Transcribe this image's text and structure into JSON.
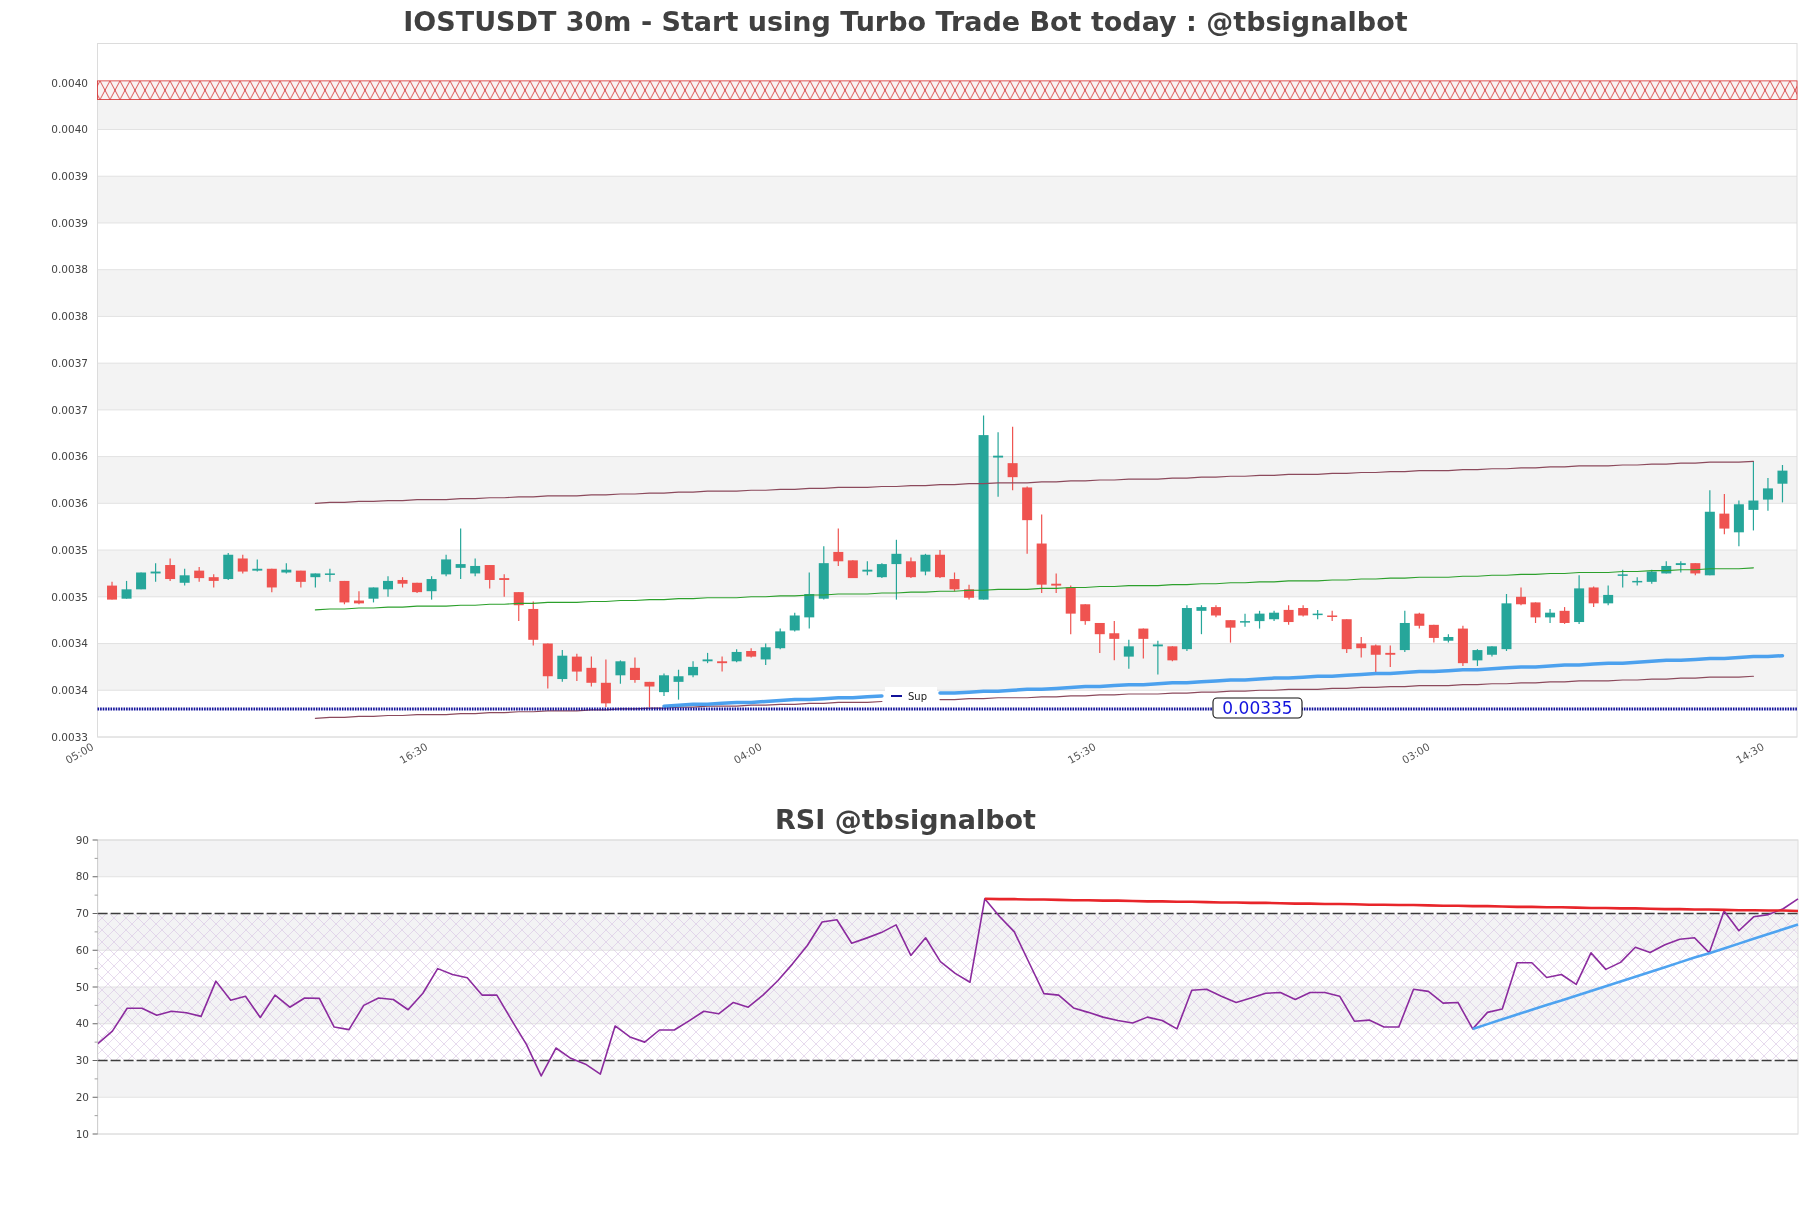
{
  "price_chart": {
    "chart_data": {
      "type": "candlestick",
      "title": "IOSTUSDT 30m - Start using Turbo Trade Bot today : @tbsignalbot",
      "grid": true,
      "categories": [
        "05:00",
        null,
        null,
        null,
        null,
        null,
        null,
        null,
        null,
        null,
        null,
        null,
        null,
        null,
        null,
        null,
        null,
        null,
        null,
        null,
        null,
        null,
        null,
        "16:30",
        null,
        null,
        null,
        null,
        null,
        null,
        null,
        null,
        null,
        null,
        null,
        null,
        null,
        null,
        null,
        null,
        null,
        null,
        null,
        null,
        null,
        null,
        "04:00",
        null,
        null,
        null,
        null,
        null,
        null,
        null,
        null,
        null,
        null,
        null,
        null,
        null,
        null,
        null,
        null,
        null,
        null,
        null,
        null,
        null,
        null,
        "15:30",
        null,
        null,
        null,
        null,
        null,
        null,
        null,
        null,
        null,
        null,
        null,
        null,
        null,
        null,
        null,
        null,
        null,
        null,
        null,
        null,
        null,
        null,
        "03:00",
        null,
        null,
        null,
        null,
        null,
        null,
        null,
        null,
        null,
        null,
        null,
        null,
        null,
        null,
        null,
        null,
        null,
        null,
        null,
        null,
        null,
        null,
        "14:30",
        null
      ],
      "ylim": [
        0.00332,
        0.004062
      ],
      "yticks": [
        {
          "value": 0.00332,
          "label": "0.0033"
        },
        {
          "value": 0.00337,
          "label": "0.0034"
        },
        {
          "value": 0.00342,
          "label": "0.0034"
        },
        {
          "value": 0.00347,
          "label": "0.0035"
        },
        {
          "value": 0.00352,
          "label": "0.0035"
        },
        {
          "value": 0.00357,
          "label": "0.0036"
        },
        {
          "value": 0.00362,
          "label": "0.0036"
        },
        {
          "value": 0.00367,
          "label": "0.0037"
        },
        {
          "value": 0.00372,
          "label": "0.0037"
        },
        {
          "value": 0.00377,
          "label": "0.0038"
        },
        {
          "value": 0.00382,
          "label": "0.0038"
        },
        {
          "value": 0.00387,
          "label": "0.0039"
        },
        {
          "value": 0.00392,
          "label": "0.0039"
        },
        {
          "value": 0.00397,
          "label": "0.0040"
        },
        {
          "value": 0.00402,
          "label": "0.0040"
        }
      ],
      "ohlc": [
        null,
        [
          0.003482,
          0.003486,
          0.003467,
          0.003467
        ],
        [
          0.003468,
          0.003487,
          0.003468,
          0.003478
        ],
        [
          0.003478,
          0.003496,
          0.003478,
          0.003496
        ],
        [
          0.003495,
          0.003506,
          0.003486,
          0.003497
        ],
        [
          0.003504,
          0.003511,
          0.003487,
          0.003489
        ],
        [
          0.003485,
          0.0035,
          0.003482,
          0.003493
        ],
        [
          0.003498,
          0.003502,
          0.003486,
          0.00349
        ],
        [
          0.003491,
          0.003494,
          0.00348,
          0.003487
        ],
        [
          0.003489,
          0.003517,
          0.003488,
          0.003515
        ],
        [
          0.003511,
          0.003515,
          0.003495,
          0.003497
        ],
        [
          0.003498,
          0.00351,
          0.003497,
          0.0035
        ],
        [
          0.0035,
          0.0035,
          0.003475,
          0.00348
        ],
        [
          0.003496,
          0.003506,
          0.003495,
          0.003499
        ],
        [
          0.003498,
          0.003498,
          0.00348,
          0.003486
        ],
        [
          0.003491,
          0.003495,
          0.00348,
          0.003495
        ],
        [
          0.003494,
          0.0035,
          0.003486,
          0.003495
        ],
        [
          0.003487,
          0.003487,
          0.003462,
          0.003464
        ],
        [
          0.003466,
          0.003476,
          0.003462,
          0.003463
        ],
        [
          0.003468,
          0.00348,
          0.003464,
          0.00348
        ],
        [
          0.003478,
          0.003492,
          0.00347,
          0.003487
        ],
        [
          0.003488,
          0.003491,
          0.00348,
          0.003484
        ],
        [
          0.003485,
          0.003485,
          0.003474,
          0.003475
        ],
        [
          0.003476,
          0.003492,
          0.003467,
          0.003489
        ],
        [
          0.003494,
          0.003515,
          0.003492,
          0.00351
        ],
        [
          0.003501,
          0.003543,
          0.003489,
          0.003505
        ],
        [
          0.003495,
          0.003511,
          0.003492,
          0.003503
        ],
        [
          0.003504,
          0.003504,
          0.003479,
          0.003488
        ],
        [
          0.00349,
          0.003494,
          0.00347,
          0.003488
        ],
        [
          0.003475,
          0.003475,
          0.003444,
          0.003461
        ],
        [
          0.003457,
          0.003465,
          0.003418,
          0.003424
        ],
        [
          0.00342,
          0.00342,
          0.003372,
          0.003385
        ],
        [
          0.003382,
          0.003413,
          0.003379,
          0.003407
        ],
        [
          0.003406,
          0.003409,
          0.00338,
          0.00339
        ],
        [
          0.003394,
          0.003406,
          0.003374,
          0.003378
        ],
        [
          0.003378,
          0.003403,
          0.003352,
          0.003356
        ],
        [
          0.003386,
          0.003402,
          0.003377,
          0.003401
        ],
        [
          0.003394,
          0.003405,
          0.003378,
          0.003381
        ],
        [
          0.003379,
          0.003379,
          0.003352,
          0.003374
        ],
        [
          0.003368,
          0.003388,
          0.003364,
          0.003386
        ],
        [
          0.003379,
          0.003392,
          0.00336,
          0.003385
        ],
        [
          0.003386,
          0.003401,
          0.003384,
          0.003395
        ],
        [
          0.003401,
          0.00341,
          0.003399,
          0.003403
        ],
        [
          0.003401,
          0.003406,
          0.00339,
          0.003399
        ],
        [
          0.003401,
          0.003414,
          0.0034,
          0.003411
        ],
        [
          0.003412,
          0.003415,
          0.003405,
          0.003406
        ],
        [
          0.003403,
          0.00342,
          0.003397,
          0.003416
        ],
        [
          0.003415,
          0.003436,
          0.003414,
          0.003433
        ],
        [
          0.003434,
          0.003453,
          0.003433,
          0.00345
        ],
        [
          0.003448,
          0.003496,
          0.003436,
          0.003473
        ],
        [
          0.003468,
          0.003524,
          0.003467,
          0.003506
        ],
        [
          0.003518,
          0.003543,
          0.003503,
          0.003508
        ],
        [
          0.003509,
          0.003509,
          0.00349,
          0.00349
        ],
        [
          0.003497,
          0.003508,
          0.003493,
          0.003499
        ],
        [
          0.003491,
          0.003506,
          0.00349,
          0.003505
        ],
        [
          0.003505,
          0.003531,
          0.003467,
          0.003516
        ],
        [
          0.003508,
          0.003512,
          0.00349,
          0.003491
        ],
        [
          0.003497,
          0.003516,
          0.003493,
          0.003515
        ],
        [
          0.003515,
          0.00352,
          0.00349,
          0.003491
        ],
        [
          0.003489,
          0.003496,
          0.003476,
          0.003478
        ],
        [
          0.003478,
          0.003483,
          0.003467,
          0.003469
        ],
        [
          0.003467,
          0.003664,
          0.003467,
          0.003643
        ],
        [
          0.003619,
          0.003646,
          0.003577,
          0.003621
        ],
        [
          0.003613,
          0.003652,
          0.003584,
          0.003598
        ],
        [
          0.003587,
          0.003588,
          0.003516,
          0.003552
        ],
        [
          0.003527,
          0.003558,
          0.003474,
          0.003483
        ],
        [
          0.003484,
          0.003495,
          0.003474,
          0.003482
        ],
        [
          0.00348,
          0.003482,
          0.00343,
          0.003452
        ],
        [
          0.003462,
          0.003462,
          0.00344,
          0.003444
        ],
        [
          0.003442,
          0.003442,
          0.00341,
          0.00343
        ],
        [
          0.003431,
          0.003444,
          0.003402,
          0.003425
        ],
        [
          0.003406,
          0.003424,
          0.003393,
          0.003417
        ],
        [
          0.003436,
          0.003436,
          0.003404,
          0.003425
        ],
        [
          0.003417,
          0.003423,
          0.003387,
          0.003419
        ],
        [
          0.003417,
          0.003417,
          0.003401,
          0.003402
        ],
        [
          0.003414,
          0.003461,
          0.003412,
          0.003458
        ],
        [
          0.003455,
          0.003461,
          0.00343,
          0.003459
        ],
        [
          0.003459,
          0.003461,
          0.003448,
          0.00345
        ],
        [
          0.003445,
          0.003445,
          0.003421,
          0.003437
        ],
        [
          0.003443,
          0.003452,
          0.003438,
          0.003444
        ],
        [
          0.003444,
          0.003455,
          0.003436,
          0.003452
        ],
        [
          0.003446,
          0.003455,
          0.003444,
          0.003453
        ],
        [
          0.003456,
          0.003461,
          0.00344,
          0.003443
        ],
        [
          0.003458,
          0.003461,
          0.003449,
          0.00345
        ],
        [
          0.003451,
          0.003456,
          0.003446,
          0.003452
        ],
        [
          0.00345,
          0.003455,
          0.003444,
          0.003449
        ],
        [
          0.003446,
          0.003446,
          0.00341,
          0.003414
        ],
        [
          0.00342,
          0.003427,
          0.003405,
          0.003415
        ],
        [
          0.003418,
          0.003419,
          0.003388,
          0.003408
        ],
        [
          0.00341,
          0.003418,
          0.003395,
          0.003408
        ],
        [
          0.003413,
          0.003455,
          0.003411,
          0.003442
        ],
        [
          0.003452,
          0.003453,
          0.003436,
          0.003439
        ],
        [
          0.00344,
          0.00344,
          0.003421,
          0.003426
        ],
        [
          0.003423,
          0.00343,
          0.003421,
          0.003427
        ],
        [
          0.003436,
          0.003439,
          0.003396,
          0.003399
        ],
        [
          0.003402,
          0.003414,
          0.003396,
          0.003413
        ],
        [
          0.003408,
          0.003417,
          0.003406,
          0.003417
        ],
        [
          0.003414,
          0.003473,
          0.003412,
          0.003463
        ],
        [
          0.00347,
          0.00348,
          0.003461,
          0.003462
        ],
        [
          0.003464,
          0.003464,
          0.003442,
          0.003448
        ],
        [
          0.003448,
          0.003457,
          0.003442,
          0.003453
        ],
        [
          0.003455,
          0.003459,
          0.003441,
          0.003442
        ],
        [
          0.003443,
          0.003493,
          0.003441,
          0.003479
        ],
        [
          0.00348,
          0.003481,
          0.003459,
          0.003463
        ],
        [
          0.003463,
          0.003482,
          0.003461,
          0.003472
        ],
        [
          0.003493,
          0.003499,
          0.00348,
          0.003494
        ],
        [
          0.003486,
          0.003491,
          0.003482,
          0.003487
        ],
        [
          0.003486,
          0.003499,
          0.003484,
          0.003497
        ],
        [
          0.003495,
          0.003508,
          0.003495,
          0.003503
        ],
        [
          0.003504,
          0.003508,
          0.003496,
          0.003506
        ],
        [
          0.003506,
          0.003506,
          0.003493,
          0.003495
        ],
        [
          0.003493,
          0.003584,
          0.003493,
          0.003561
        ],
        [
          0.003559,
          0.00358,
          0.003537,
          0.003543
        ],
        [
          0.003539,
          0.003573,
          0.003524,
          0.003569
        ],
        [
          0.003563,
          0.003615,
          0.003541,
          0.003573
        ],
        [
          0.003574,
          0.003597,
          0.003562,
          0.003586
        ],
        [
          0.003591,
          0.003611,
          0.003571,
          0.003605
        ]
      ],
      "series": [
        {
          "type": "line",
          "color": "#8c4a5c",
          "values": [
            null,
            null,
            null,
            null,
            null,
            null,
            null,
            null,
            null,
            null,
            null,
            null,
            null,
            null,
            null,
            0.00357,
            0.003571,
            0.003571,
            0.003572,
            0.003572,
            0.003573,
            0.003573,
            0.003574,
            0.003574,
            0.003574,
            0.003575,
            0.003575,
            0.003576,
            0.003576,
            0.003577,
            0.003577,
            0.003578,
            0.003578,
            0.003578,
            0.003579,
            0.003579,
            0.00358,
            0.00358,
            0.003581,
            0.003581,
            0.003582,
            0.003582,
            0.003583,
            0.003583,
            0.003583,
            0.003584,
            0.003584,
            0.003585,
            0.003585,
            0.003586,
            0.003586,
            0.003587,
            0.003587,
            0.003587,
            0.003588,
            0.003588,
            0.003589,
            0.003589,
            0.00359,
            0.00359,
            0.003591,
            0.003591,
            0.003592,
            0.003592,
            0.003592,
            0.003593,
            0.003593,
            0.003594,
            0.003594,
            0.003595,
            0.003595,
            0.003596,
            0.003596,
            0.003596,
            0.003597,
            0.003597,
            0.003598,
            0.003598,
            0.003599,
            0.003599,
            0.0036,
            0.0036,
            0.003601,
            0.003601,
            0.003601,
            0.003602,
            0.003602,
            0.003603,
            0.003603,
            0.003604,
            0.003604,
            0.003605,
            0.003605,
            0.003605,
            0.003606,
            0.003606,
            0.003607,
            0.003607,
            0.003608,
            0.003608,
            0.003609,
            0.003609,
            0.00361,
            0.00361,
            0.00361,
            0.003611,
            0.003611,
            0.003612,
            0.003612,
            0.003613,
            0.003613,
            0.003614,
            0.003614,
            0.003614,
            0.003615,
            null,
            null
          ]
        },
        {
          "type": "line",
          "color": "#2ca02c",
          "values": [
            null,
            null,
            null,
            null,
            null,
            null,
            null,
            null,
            null,
            null,
            null,
            null,
            null,
            null,
            null,
            0.003456,
            0.003457,
            0.003457,
            0.003458,
            0.003458,
            0.003459,
            0.003459,
            0.00346,
            0.00346,
            0.00346,
            0.003461,
            0.003461,
            0.003462,
            0.003462,
            0.003463,
            0.003463,
            0.003464,
            0.003464,
            0.003464,
            0.003465,
            0.003465,
            0.003466,
            0.003466,
            0.003467,
            0.003467,
            0.003468,
            0.003468,
            0.003469,
            0.003469,
            0.003469,
            0.00347,
            0.00347,
            0.003471,
            0.003471,
            0.003472,
            0.003472,
            0.003473,
            0.003473,
            0.003473,
            0.003474,
            0.003474,
            0.003475,
            0.003475,
            0.003476,
            0.003476,
            0.003477,
            0.003477,
            0.003478,
            0.003478,
            0.003478,
            0.003479,
            0.003479,
            0.00348,
            0.00348,
            0.003481,
            0.003481,
            0.003482,
            0.003482,
            0.003482,
            0.003483,
            0.003483,
            0.003484,
            0.003484,
            0.003485,
            0.003485,
            0.003486,
            0.003486,
            0.003487,
            0.003487,
            0.003487,
            0.003488,
            0.003488,
            0.003489,
            0.003489,
            0.00349,
            0.00349,
            0.003491,
            0.003491,
            0.003491,
            0.003492,
            0.003492,
            0.003493,
            0.003493,
            0.003494,
            0.003494,
            0.003495,
            0.003495,
            0.003496,
            0.003496,
            0.003496,
            0.003497,
            0.003497,
            0.003498,
            0.003498,
            0.003499,
            0.003499,
            0.0035,
            0.0035,
            0.0035,
            0.003501,
            null,
            null
          ]
        },
        {
          "type": "line",
          "color": "#8c4a5c",
          "values": [
            null,
            null,
            null,
            null,
            null,
            null,
            null,
            null,
            null,
            null,
            null,
            null,
            null,
            null,
            null,
            0.00334,
            0.003341,
            0.003341,
            0.003342,
            0.003342,
            0.003343,
            0.003343,
            0.003344,
            0.003344,
            0.003344,
            0.003345,
            0.003345,
            0.003346,
            0.003346,
            0.003347,
            0.003347,
            0.003348,
            0.003348,
            0.003348,
            0.003349,
            0.003349,
            0.00335,
            0.00335,
            0.003351,
            0.003351,
            0.003352,
            0.003352,
            0.003353,
            0.003353,
            0.003353,
            0.003354,
            0.003354,
            0.003355,
            0.003355,
            0.003356,
            0.003356,
            0.003357,
            0.003357,
            0.003357,
            0.003358,
            null,
            null,
            null,
            0.00336,
            0.00336,
            0.003361,
            0.003361,
            0.003362,
            0.003362,
            0.003362,
            0.003363,
            0.003363,
            0.003364,
            0.003364,
            0.003365,
            0.003365,
            0.003366,
            0.003366,
            0.003366,
            0.003367,
            0.003367,
            0.003368,
            0.003368,
            0.003369,
            0.003369,
            0.00337,
            0.00337,
            0.003371,
            0.003371,
            0.003371,
            0.003372,
            0.003372,
            0.003373,
            0.003373,
            0.003374,
            0.003374,
            0.003375,
            0.003375,
            0.003375,
            0.003376,
            0.003376,
            0.003377,
            0.003377,
            0.003378,
            0.003378,
            0.003379,
            0.003379,
            0.00338,
            0.00338,
            0.00338,
            0.003381,
            0.003381,
            0.003382,
            0.003382,
            0.003383,
            0.003383,
            0.003384,
            0.003384,
            0.003384,
            0.003385,
            null,
            null
          ]
        },
        {
          "type": "line",
          "color": "#4ca1ee",
          "values": [
            null,
            null,
            null,
            null,
            null,
            null,
            null,
            null,
            null,
            null,
            null,
            null,
            null,
            null,
            null,
            null,
            null,
            null,
            null,
            null,
            null,
            null,
            null,
            null,
            null,
            null,
            null,
            null,
            null,
            null,
            null,
            null,
            null,
            null,
            null,
            null,
            null,
            null,
            null,
            0.003353,
            0.003354,
            0.003355,
            0.003355,
            0.003356,
            0.003357,
            0.003357,
            0.003358,
            0.003359,
            0.00336,
            0.00336,
            0.003361,
            0.003362,
            0.003362,
            0.003363,
            0.003364,
            null,
            null,
            null,
            0.003367,
            0.003367,
            0.003368,
            0.003369,
            0.003369,
            0.00337,
            0.003371,
            0.003371,
            0.003372,
            0.003373,
            0.003374,
            0.003374,
            0.003375,
            0.003376,
            0.003376,
            0.003377,
            0.003378,
            0.003378,
            0.003379,
            0.00338,
            0.003381,
            0.003381,
            0.003382,
            0.003383,
            0.003383,
            0.003384,
            0.003385,
            0.003385,
            0.003386,
            0.003387,
            0.003388,
            0.003388,
            0.003389,
            0.00339,
            0.00339,
            0.003391,
            0.003392,
            0.003392,
            0.003393,
            0.003394,
            0.003395,
            0.003395,
            0.003396,
            0.003397,
            0.003397,
            0.003398,
            0.003399,
            0.003399,
            0.0034,
            0.003401,
            0.003402,
            0.003402,
            0.003403,
            0.003404,
            0.003404,
            0.003405,
            0.003406,
            0.003406,
            0.003407
          ]
        }
      ],
      "ref_lines": [
        {
          "axis": "y",
          "value": 0.00335,
          "label": "0.00335"
        }
      ],
      "bands": [
        {
          "axis": "y",
          "from": 0.004002,
          "to": 0.004022
        }
      ]
    },
    "legend": [
      {
        "label": "Sup"
      }
    ]
  },
  "rsi_chart": {
    "chart_data": {
      "type": "line",
      "title": "RSI @tbsignalbot",
      "grid": true,
      "ylim": [
        10,
        90
      ],
      "yticks": [
        10,
        20,
        30,
        40,
        50,
        60,
        70,
        80,
        90
      ],
      "series": [
        {
          "color": "#8b2b9e",
          "values": [
            34.5,
            38,
            44.2,
            44.2,
            42.3,
            43.4,
            43,
            42,
            51.6,
            46.4,
            47.5,
            41.7,
            47.8,
            44.5,
            47,
            46.9,
            39.1,
            38.4,
            45,
            47,
            46.6,
            43.8,
            48.3,
            55,
            53.4,
            52.5,
            47.8,
            47.8,
            41,
            34.4,
            25.8,
            33.4,
            30.6,
            29,
            26.3,
            39.4,
            36.4,
            35,
            38.3,
            38.3,
            40.8,
            43.4,
            42.7,
            45.8,
            44.5,
            47.8,
            51.7,
            56.3,
            61.3,
            67.7,
            68.3,
            61.9,
            63.3,
            64.8,
            66.9,
            58.6,
            63.4,
            56.9,
            53.7,
            51.3,
            74,
            69.2,
            65,
            56.6,
            48.2,
            47.8,
            44.3,
            43.1,
            41.8,
            40.9,
            40.2,
            41.8,
            40.9,
            38.6,
            49.1,
            49.4,
            47.5,
            45.8,
            47,
            48.3,
            48.5,
            46.6,
            48.5,
            48.5,
            47.5,
            40.7,
            41,
            39.1,
            39.1,
            49.4,
            48.8,
            45.6,
            45.8,
            38.6,
            43.1,
            44,
            56.6,
            56.6,
            52.6,
            53.4,
            50.7,
            59.3,
            54.8,
            56.7,
            60.8,
            59.4,
            61.5,
            63,
            63.4,
            59.3,
            70.7,
            65.3,
            69.1,
            69.7,
            71.3,
            74
          ]
        },
        {
          "color": "#e8252a",
          "values": [
            null,
            null,
            null,
            null,
            null,
            null,
            null,
            null,
            null,
            null,
            null,
            null,
            null,
            null,
            null,
            null,
            null,
            null,
            null,
            null,
            null,
            null,
            null,
            null,
            null,
            null,
            null,
            null,
            null,
            null,
            null,
            null,
            null,
            null,
            null,
            null,
            null,
            null,
            null,
            null,
            null,
            null,
            null,
            null,
            null,
            null,
            null,
            null,
            null,
            null,
            null,
            null,
            null,
            null,
            null,
            null,
            null,
            null,
            null,
            null,
            74,
            73.9,
            73.9,
            73.8,
            73.8,
            73.7,
            73.6,
            73.6,
            73.5,
            73.5,
            73.4,
            73.3,
            73.3,
            73.2,
            73.2,
            73.1,
            73,
            73,
            72.9,
            72.9,
            72.8,
            72.7,
            72.7,
            72.6,
            72.6,
            72.5,
            72.4,
            72.4,
            72.3,
            72.3,
            72.2,
            72.1,
            72.1,
            72,
            72,
            71.9,
            71.8,
            71.8,
            71.7,
            71.7,
            71.6,
            71.5,
            71.5,
            71.4,
            71.4,
            71.3,
            71.2,
            71.2,
            71.1,
            71.1,
            71,
            70.9,
            70.9,
            70.8,
            70.8,
            70.7
          ]
        },
        {
          "color": "#4ea3f0",
          "values": [
            null,
            null,
            null,
            null,
            null,
            null,
            null,
            null,
            null,
            null,
            null,
            null,
            null,
            null,
            null,
            null,
            null,
            null,
            null,
            null,
            null,
            null,
            null,
            null,
            null,
            null,
            null,
            null,
            null,
            null,
            null,
            null,
            null,
            null,
            null,
            null,
            null,
            null,
            null,
            null,
            null,
            null,
            null,
            null,
            null,
            null,
            null,
            null,
            null,
            null,
            null,
            null,
            null,
            null,
            null,
            null,
            null,
            null,
            null,
            null,
            null,
            null,
            null,
            null,
            null,
            null,
            null,
            null,
            null,
            null,
            null,
            null,
            null,
            null,
            null,
            null,
            null,
            null,
            null,
            null,
            null,
            null,
            null,
            null,
            null,
            null,
            null,
            null,
            null,
            null,
            null,
            null,
            null,
            38.6,
            39.9,
            41.2,
            42.5,
            43.8,
            45.1,
            46.3,
            47.6,
            48.9,
            50.2,
            51.5,
            52.8,
            54.1,
            55.4,
            56.7,
            58,
            59.2,
            60.5,
            61.8,
            63.1,
            64.4,
            65.7,
            67
          ]
        }
      ],
      "bands": [
        {
          "axis": "y",
          "from": 30,
          "to": 70
        }
      ]
    }
  }
}
